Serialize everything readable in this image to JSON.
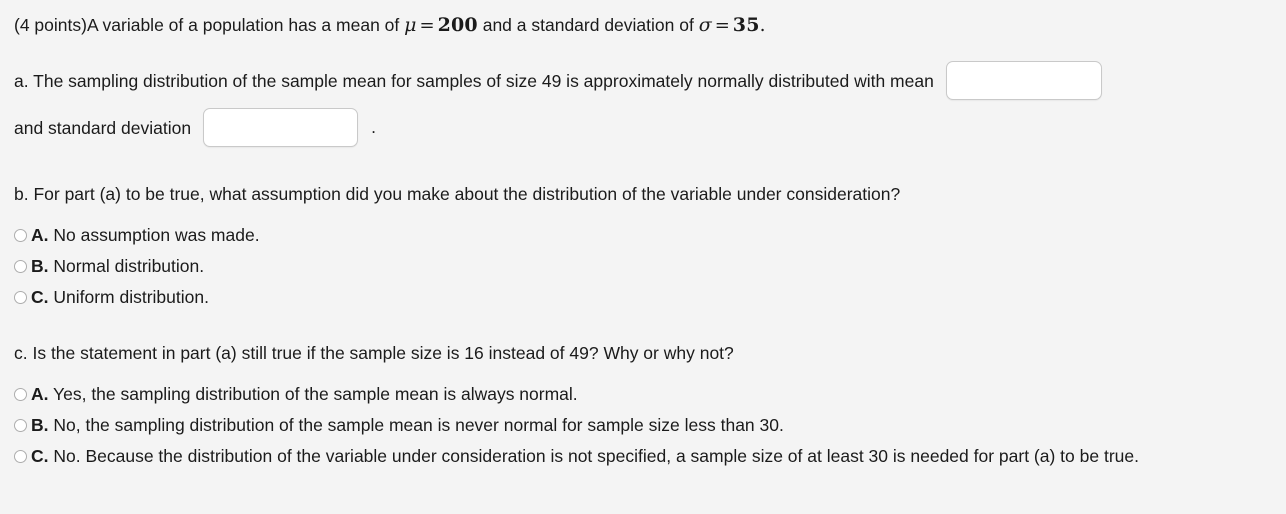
{
  "question": {
    "points_label": "(4 points)",
    "intro_text_1": "A variable of a population has a mean of ",
    "mu_symbol": "μ",
    "equals": "=",
    "mu_value": "200",
    "intro_text_2": " and a standard deviation of ",
    "sigma_symbol": "σ",
    "sigma_value": "35",
    "intro_text_3": "."
  },
  "part_a": {
    "text_before_mean_input": "a. The sampling distribution of the sample mean for samples of size 49 is approximately normally distributed with mean",
    "mean_input_value": "",
    "mean_input_placeholder": "",
    "text_before_sd_input": "and standard deviation",
    "sd_input_value": "",
    "sd_input_placeholder": "",
    "trailing_period": "."
  },
  "part_b": {
    "prompt": "b. For part (a) to be true, what assumption did you make about the distribution of the variable under consideration?",
    "options": [
      {
        "letter": "A.",
        "text": " No assumption was made.",
        "selected": false
      },
      {
        "letter": "B.",
        "text": " Normal distribution.",
        "selected": false
      },
      {
        "letter": "C.",
        "text": " Uniform distribution.",
        "selected": false
      }
    ]
  },
  "part_c": {
    "prompt": "c. Is the statement in part (a) still true if the sample size is 16 instead of 49? Why or why not?",
    "options": [
      {
        "letter": "A.",
        "text": " Yes, the sampling distribution of the sample mean is always normal.",
        "selected": false
      },
      {
        "letter": "B.",
        "text": " No, the sampling distribution of the sample mean is never normal for sample size less than 30.",
        "selected": false
      },
      {
        "letter": "C.",
        "text": " No. Because the distribution of the variable under consideration is not specified, a sample size of at least 30 is needed for part (a) to be true.",
        "selected": false
      }
    ]
  },
  "colors": {
    "background": "#f4f4f4",
    "text": "#1b1b1b",
    "input_border": "#c9c9c9",
    "radio_border": "#adadad",
    "input_fill": "#ffffff"
  }
}
